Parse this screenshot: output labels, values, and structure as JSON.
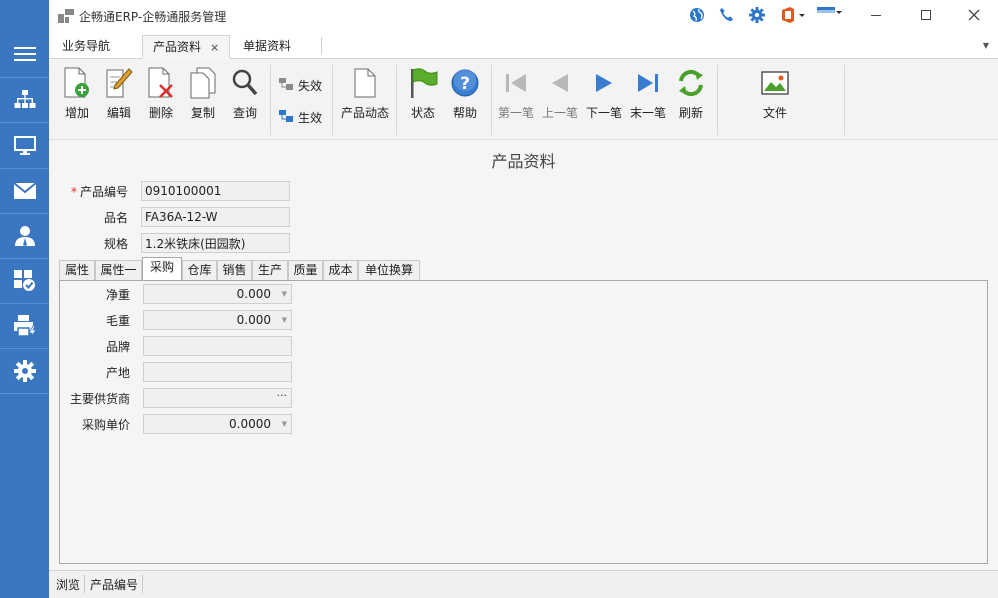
{
  "window": {
    "title": "企畅通ERP-企畅通服务管理"
  },
  "tabs": [
    {
      "label": "业务导航"
    },
    {
      "label": "产品资料",
      "close": "×"
    },
    {
      "label": "单据资料"
    }
  ],
  "toolbar": {
    "add": "增加",
    "edit": "编辑",
    "delete": "删除",
    "copy": "复制",
    "query": "查询",
    "invalidate": "失效",
    "validate": "生效",
    "product_dynamics": "产品动态",
    "status": "状态",
    "help": "帮助",
    "first": "第一笔",
    "prev": "上一笔",
    "next": "下一笔",
    "last": "末一笔",
    "refresh": "刷新",
    "file": "文件"
  },
  "form": {
    "title": "产品资料",
    "required_mark": "*",
    "product_code_label": "产品编号",
    "product_code_value": "0910100001",
    "name_label": "品名",
    "name_value": "FA36A-12-W",
    "spec_label": "规格",
    "spec_value": "1.2米铁床(田园款)"
  },
  "detail_tabs": [
    {
      "label": "属性"
    },
    {
      "label": "属性一"
    },
    {
      "label": "采购",
      "active": true
    },
    {
      "label": "仓库"
    },
    {
      "label": "销售"
    },
    {
      "label": "生产"
    },
    {
      "label": "质量"
    },
    {
      "label": "成本"
    },
    {
      "label": "单位换算"
    }
  ],
  "purchase": {
    "net_weight_label": "净重",
    "net_weight_value": "0.000",
    "gross_weight_label": "毛重",
    "gross_weight_value": "0.000",
    "brand_label": "品牌",
    "brand_value": "",
    "origin_label": "产地",
    "origin_value": "",
    "main_supplier_label": "主要供货商",
    "main_supplier_value": "",
    "purchase_price_label": "采购单价",
    "purchase_price_value": "0.0000"
  },
  "statusbar": {
    "mode": "浏览",
    "field": "产品编号"
  },
  "colors": {
    "sidebar": "#3b76c1",
    "accent_blue": "#2d77c9",
    "required": "#d9302c"
  }
}
